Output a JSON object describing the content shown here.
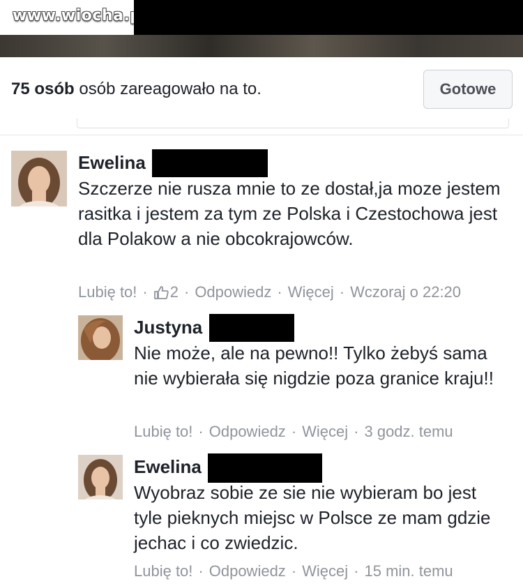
{
  "watermark": "www.wiocha.pl",
  "header": {
    "reactions_count": "75 osób",
    "reactions_text": "osób zareagowało na to.",
    "done_label": "Gotowe"
  },
  "comments": [
    {
      "author": "Ewelina",
      "text": "Szczerze nie rusza mnie to ze dostał,ja moze jestem rasitka i jestem za tym ze Polska i Czestochowa jest dla Polakow a nie obcokrajowców.",
      "like": "Lubię to!",
      "likes_count": "2",
      "reply": "Odpowiedz",
      "more": "Więcej",
      "time": "Wczoraj o 22:20"
    },
    {
      "author": "Justyna",
      "text": "Nie może, ale na pewno!! Tylko żebyś sama nie wybierała się nigdzie poza granice kraju!!",
      "like": "Lubię to!",
      "reply": "Odpowiedz",
      "more": "Więcej",
      "time": "3 godz. temu"
    },
    {
      "author": "Ewelina",
      "text": "Wyobraz sobie ze sie nie wybieram bo jest tyle pieknych miejsc w Polsce ze mam gdzie jechac i co zwiedzic.",
      "like": "Lubię to!",
      "reply": "Odpowiedz",
      "more": "Więcej",
      "time": "15 min. temu"
    }
  ],
  "icons": {
    "thumbs_up": "thumbs-up-icon"
  },
  "colors": {
    "meta_gray": "#90949c",
    "text": "#1d2129",
    "redaction": "#000000"
  }
}
